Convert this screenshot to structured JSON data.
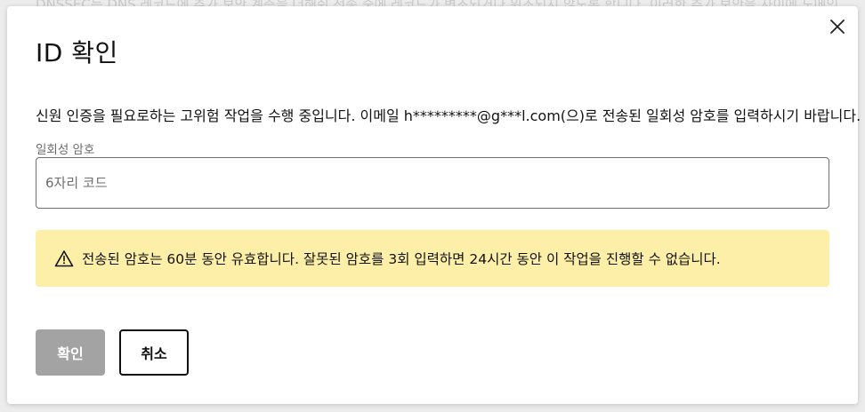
{
  "dialog": {
    "title": "ID 확인",
    "description": "신원 인증을 필요로하는 고위험 작업을 수행 중입니다. 이메일 h*********@g***l.com(으)로 전송된 일회성 암호를 입력하시기 바랍니다.",
    "otp_field": {
      "label": "일회성 암호",
      "placeholder": "6자리 코드",
      "value": ""
    },
    "warning": {
      "icon": "warning-triangle-icon",
      "text": "전송된 암호는 60분 동안 유효합니다. 잘못된 암호를 3회 입력하면 24시간 동안 이 작업을 진행할 수 없습니다.",
      "background_color": "#fdefa8"
    },
    "buttons": {
      "confirm_label": "확인",
      "cancel_label": "취소"
    },
    "close_icon": "close-icon"
  },
  "background": {
    "partial_text": "DNSSEC는 DNS 레코드에 추가 보안 계층을 더해줘 전송 중에 레코드가 변조되거나 위조되지 않도록 합니다. 이러한 추가 보안을 사이에 도메인"
  },
  "colors": {
    "confirm_button_disabled": "#a3a3a3",
    "text_primary": "#111111"
  }
}
